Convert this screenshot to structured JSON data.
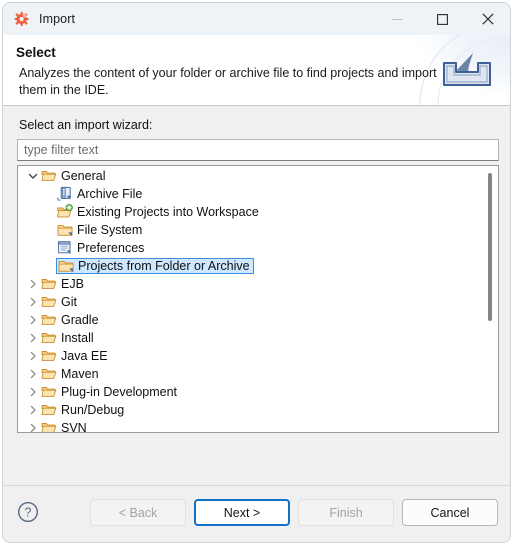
{
  "window": {
    "title": "Import",
    "app_icon": "eclipse-gear-icon",
    "controls": {
      "minimize": "minimize-icon",
      "maximize": "maximize-icon",
      "close": "close-icon"
    }
  },
  "header": {
    "title": "Select",
    "description": "Analyzes the content of your folder or archive file to find projects and import them in the IDE.",
    "banner_icon": "import-arrow-into-tray-icon"
  },
  "main": {
    "field_label": "Select an import wizard:",
    "filter": {
      "value": "",
      "placeholder": "type filter text"
    },
    "tree": {
      "selected": "Projects from Folder or Archive",
      "rows": [
        {
          "label": "General",
          "level": 0,
          "expanded": true,
          "icon": "open-folder-icon",
          "selected": false
        },
        {
          "label": "Archive File",
          "level": 1,
          "expanded": null,
          "icon": "archive-file-icon",
          "selected": false
        },
        {
          "label": "Existing Projects into Workspace",
          "level": 1,
          "expanded": null,
          "icon": "folder-add-icon",
          "selected": false
        },
        {
          "label": "File System",
          "level": 1,
          "expanded": null,
          "icon": "folder-icon",
          "selected": false
        },
        {
          "label": "Preferences",
          "level": 1,
          "expanded": null,
          "icon": "preferences-document-icon",
          "selected": false
        },
        {
          "label": "Projects from Folder or Archive",
          "level": 1,
          "expanded": null,
          "icon": "folder-icon",
          "selected": true
        },
        {
          "label": "EJB",
          "level": 0,
          "expanded": false,
          "icon": "open-folder-icon",
          "selected": false
        },
        {
          "label": "Git",
          "level": 0,
          "expanded": false,
          "icon": "open-folder-icon",
          "selected": false
        },
        {
          "label": "Gradle",
          "level": 0,
          "expanded": false,
          "icon": "open-folder-icon",
          "selected": false
        },
        {
          "label": "Install",
          "level": 0,
          "expanded": false,
          "icon": "open-folder-icon",
          "selected": false
        },
        {
          "label": "Java EE",
          "level": 0,
          "expanded": false,
          "icon": "open-folder-icon",
          "selected": false
        },
        {
          "label": "Maven",
          "level": 0,
          "expanded": false,
          "icon": "open-folder-icon",
          "selected": false
        },
        {
          "label": "Plug-in Development",
          "level": 0,
          "expanded": false,
          "icon": "open-folder-icon",
          "selected": false
        },
        {
          "label": "Run/Debug",
          "level": 0,
          "expanded": false,
          "icon": "open-folder-icon",
          "selected": false
        },
        {
          "label": "SVN",
          "level": 0,
          "expanded": false,
          "icon": "open-folder-icon",
          "selected": false
        }
      ]
    }
  },
  "footer": {
    "help_icon": "help-question-icon",
    "buttons": [
      {
        "label": "< Back",
        "state": "disabled"
      },
      {
        "label": "Next >",
        "state": "default"
      },
      {
        "label": "Finish",
        "state": "disabled"
      },
      {
        "label": "Cancel",
        "state": "normal"
      }
    ]
  },
  "colors": {
    "selection_fill": "#cde8ff",
    "selection_border": "#3b8ede",
    "default_button_border": "#1272c8",
    "titlebar_bg": "#eef3f8",
    "body_bg": "#f0f0f0",
    "folder_icon": "#e8a33d"
  }
}
